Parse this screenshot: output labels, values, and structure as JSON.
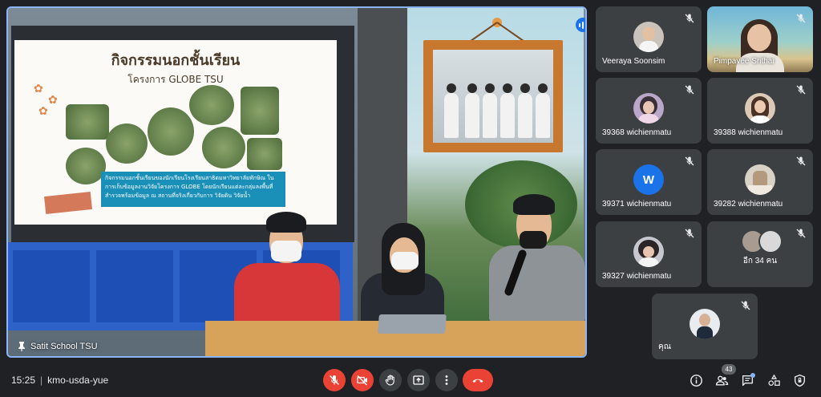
{
  "main": {
    "presenter_name": "Satit School TSU",
    "slide_title": "กิจกรรมนอกชั้นเรียน",
    "slide_subtitle": "โครงการ GLOBE TSU",
    "slide_caption": "กิจกรรมนอกชั้นเรียนของนักเรียนโรงเรียนสาธิตมหาวิทยาลัยทักษิณ ในการเก็บข้อมูลงานวิจัยโครงการ GLOBE โดยนักเรียนแต่ละกลุ่มลงพื้นที่สำรวจพร้อมข้อมูล ณ สถานที่จริงเกี่ยวกับการ วิจัยดิน วิจัยน้ำ"
  },
  "participants": [
    {
      "name": "Veeraya Soonsim",
      "type": "photo",
      "muted": true
    },
    {
      "name": "Pimpavee Srithai",
      "type": "video",
      "muted": true
    },
    {
      "name": "39368 wichienmatu",
      "type": "photo",
      "muted": true
    },
    {
      "name": "39388 wichienmatu",
      "type": "photo",
      "muted": true
    },
    {
      "name": "39371 wichienmatu",
      "type": "letter",
      "letter": "W",
      "muted": true
    },
    {
      "name": "39282 wichienmatu",
      "type": "photo",
      "muted": true
    },
    {
      "name": "39327 wichienmatu",
      "type": "photo",
      "muted": true
    },
    {
      "name": "others",
      "type": "others",
      "label": "อีก 34 คน",
      "muted": true
    },
    {
      "name": "คุณ",
      "type": "photo",
      "muted": true
    }
  ],
  "bottom_bar": {
    "time": "15:25",
    "meeting_code": "kmo-usda-yue",
    "people_count": "43",
    "controls": [
      "mic-off",
      "camera-off",
      "raise-hand",
      "present",
      "more",
      "leave-call"
    ],
    "right_icons": [
      "info",
      "people",
      "chat",
      "activities",
      "host-controls"
    ]
  },
  "colors": {
    "background": "#202124",
    "tile": "#3c4043",
    "danger": "#ea4335",
    "accent": "#1a73e8",
    "active_border": "#8ab4f8"
  }
}
